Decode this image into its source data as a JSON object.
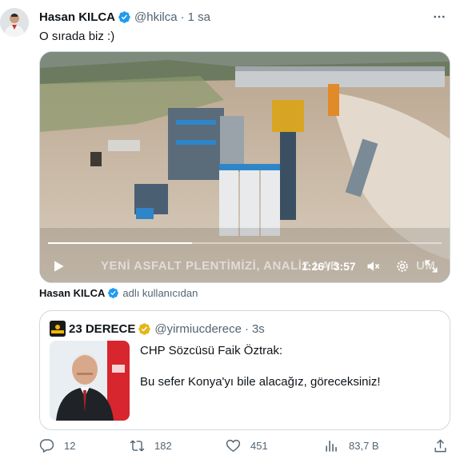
{
  "tweet": {
    "author_name": "Hasan KILCA",
    "handle": "@hkilca",
    "separator": "·",
    "time": "1 sa",
    "text": "O sırada biz :)"
  },
  "video": {
    "overlay_caption": "YENİ ASFALT PLENTİMİZİ, ANALİZ LAB",
    "overlay_caption_tail": "UM",
    "timecode": "1:26 / 3:57",
    "progress": 0.365
  },
  "attribution": {
    "name": "Hasan KILCA",
    "suffix": "adlı kullanıcıdan"
  },
  "quote": {
    "author_name": "23 DERECE",
    "handle": "@yirmiucderece",
    "separator": "·",
    "time": "3s",
    "line1": "CHP Sözcüsü Faik Öztrak:",
    "line2": "Bu sefer Konya'yı bile alacağız, göreceksiniz!"
  },
  "actions": {
    "replies": "12",
    "retweets": "182",
    "likes": "451",
    "views": "83,7 B"
  },
  "colors": {
    "text_primary": "#0f1419",
    "text_secondary": "#536471",
    "verified_blue": "#1d9bf0",
    "verified_gold": "#e2b719",
    "border": "#cfd9de"
  },
  "icons": [
    "verified-badge-icon",
    "more-icon",
    "play-icon",
    "volume-icon",
    "settings-icon",
    "fullscreen-icon",
    "reply-icon",
    "retweet-icon",
    "like-icon",
    "views-icon",
    "share-icon"
  ]
}
